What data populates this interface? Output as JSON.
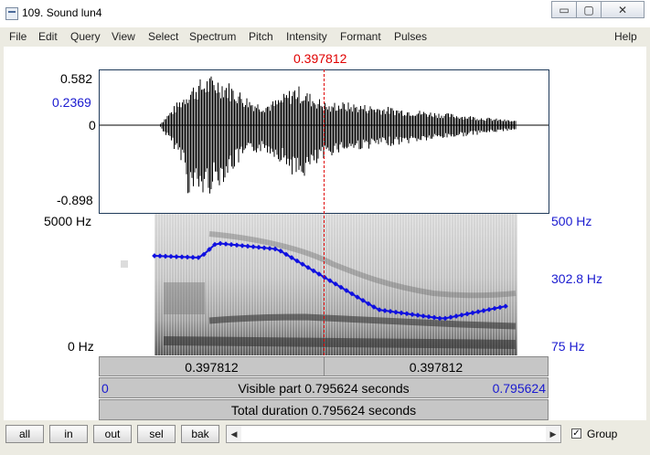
{
  "window": {
    "title": "109. Sound lun4",
    "minimize_glyph": "▭",
    "maximize_glyph": "▢",
    "close_glyph": "✕"
  },
  "menu": [
    "File",
    "Edit",
    "Query",
    "View",
    "Select",
    "Spectrum",
    "Pitch",
    "Intensity",
    "Formant",
    "Pulses",
    "Help"
  ],
  "cursor": {
    "time_label": "0.397812"
  },
  "waveform": {
    "max": "0.582",
    "cursor_value": "0.2369",
    "zero": "0",
    "min": "-0.898"
  },
  "spectrogram": {
    "top_hz": "5000 Hz",
    "bottom_hz": "0 Hz"
  },
  "pitch": {
    "top": "500 Hz",
    "mid": "302.8 Hz",
    "bottom": "75 Hz"
  },
  "info": {
    "left_time": "0.397812",
    "right_time": "0.397812",
    "visible_start": "0",
    "visible_label": "Visible part 0.795624 seconds",
    "visible_end": "0.795624",
    "total_label": "Total duration 0.795624 seconds"
  },
  "buttons": {
    "all": "all",
    "in": "in",
    "out": "out",
    "sel": "sel",
    "bak": "bak"
  },
  "group": {
    "label": "Group",
    "checked": "✓"
  },
  "colors": {
    "accent_blue": "#1a1ad0",
    "cursor_red": "#e00000",
    "pitch_blue": "#1010e0"
  }
}
